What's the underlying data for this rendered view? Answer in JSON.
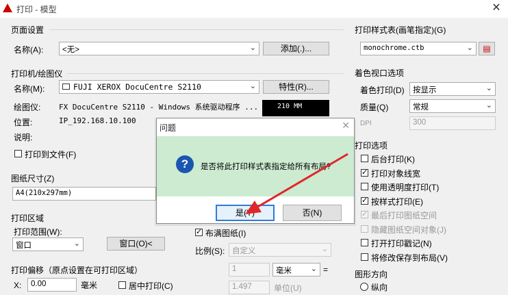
{
  "window": {
    "title": "打印 - 模型",
    "close_glyph": "✕"
  },
  "page_setup": {
    "section": "页面设置",
    "name_label": "名称(A):",
    "name_value": "<无>",
    "add_button": "添加(.)..."
  },
  "printer": {
    "section": "打印机/绘图仪",
    "name_label": "名称(M):",
    "name_value": "FUJI XEROX DocuCentre S2110",
    "properties_button": "特性(R)...",
    "plotter_label": "绘图仪:",
    "plotter_value": "FX DocuCentre S2110 - Windows 系统驱动程序 ...",
    "location_label": "位置:",
    "location_value": "IP_192.168.10.100",
    "description_label": "说明:",
    "print_to_file": "打印到文件(F)",
    "preview_text": "210 MM"
  },
  "paper_size": {
    "section": "图纸尺寸(Z)",
    "value": "A4(210x297mm)"
  },
  "plot_area": {
    "section": "打印区域",
    "range_label": "打印范围(W):",
    "range_value": "窗口",
    "window_button": "窗口(O)<"
  },
  "plot_offset": {
    "section": "打印偏移（原点设置在可打印区域）",
    "x_label": "X:",
    "x_value": "0.00",
    "x_unit": "毫米",
    "center_label": "居中打印(C)"
  },
  "scale": {
    "fit_label": "布满图纸(I)",
    "scale_label": "比例(S):",
    "scale_value": "自定义",
    "value1": "1",
    "unit_value": "毫米",
    "equals": "=",
    "value2": "1.497",
    "unit2": "单位(U)"
  },
  "plot_style_table": {
    "section": "打印样式表(画笔指定)(G)",
    "value": "monochrome.ctb"
  },
  "shaded_viewport": {
    "section": "着色视口选项",
    "shade_label": "着色打印(D)",
    "shade_value": "按显示",
    "quality_label": "质量(Q)",
    "quality_value": "常规",
    "dpi_label": "DPI",
    "dpi_value": "300"
  },
  "plot_options": {
    "section": "打印选项",
    "items": [
      {
        "label": "后台打印(K)",
        "checked": false,
        "disabled": false
      },
      {
        "label": "打印对象线宽",
        "checked": true,
        "disabled": false
      },
      {
        "label": "使用透明度打印(T)",
        "checked": false,
        "disabled": false
      },
      {
        "label": "按样式打印(E)",
        "checked": true,
        "disabled": false
      },
      {
        "label": "最后打印图纸空间",
        "checked": true,
        "disabled": true
      },
      {
        "label": "隐藏图纸空间对象(J)",
        "checked": false,
        "disabled": true
      },
      {
        "label": "打开打印戳记(N)",
        "checked": false,
        "disabled": false
      },
      {
        "label": "将修改保存到布局(V)",
        "checked": false,
        "disabled": false
      }
    ]
  },
  "orientation": {
    "section": "图形方向",
    "portrait": "纵向"
  },
  "dialog": {
    "title": "问题",
    "close_glyph": "✕",
    "icon_glyph": "?",
    "message": "是否将此打印样式表指定给所有布局?",
    "yes_button": "是(Y)",
    "no_button": "否(N)"
  },
  "colors": {
    "dialog_body": "#ccebd0",
    "arrow": "#e0262b",
    "question_icon": "#1a56b0"
  }
}
